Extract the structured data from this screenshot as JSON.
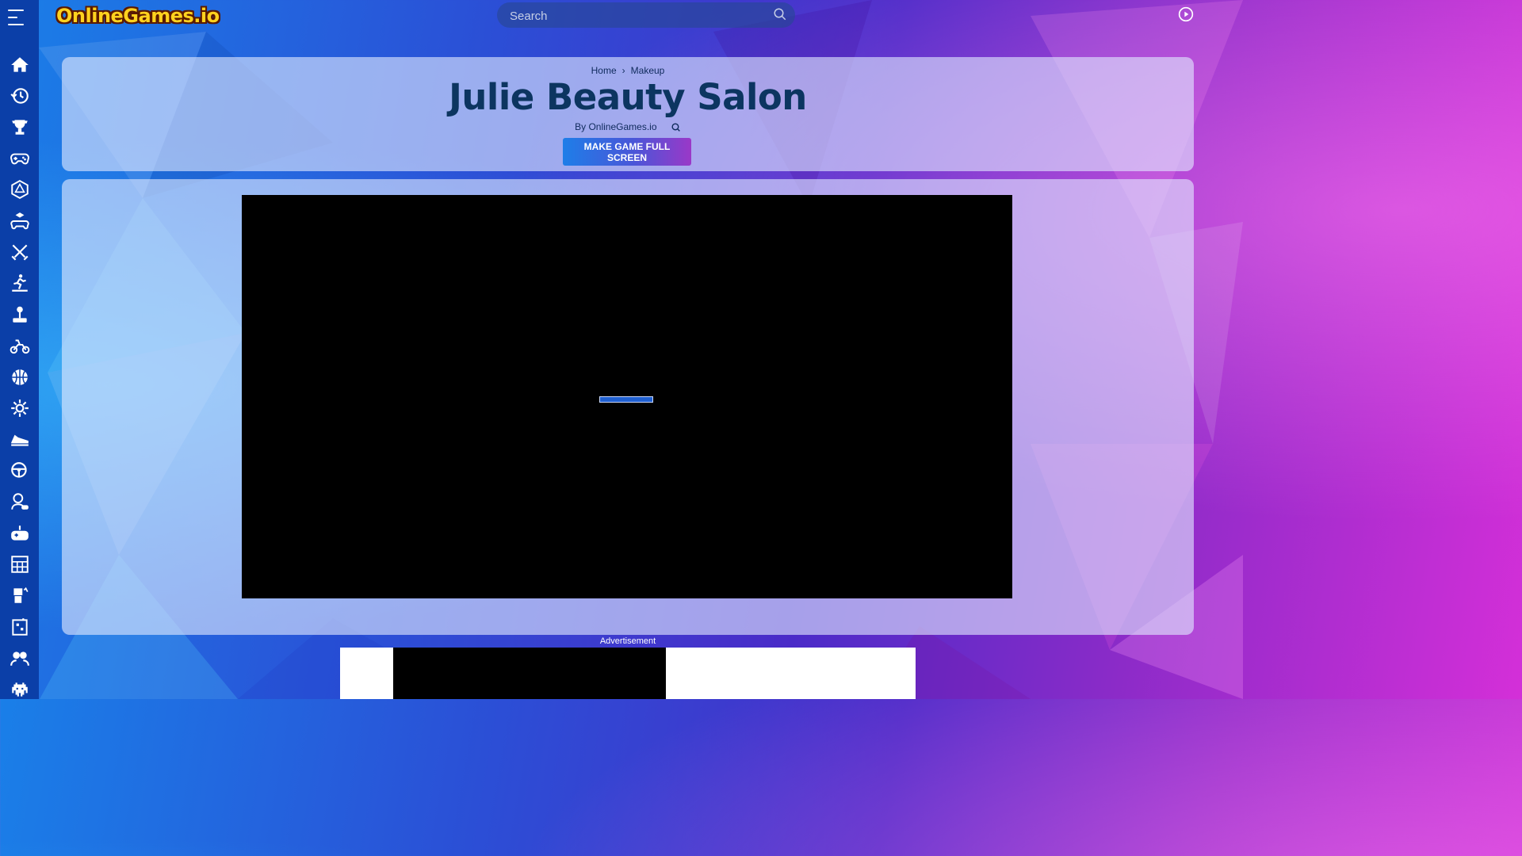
{
  "site": {
    "logo_text": "OnlineGames.io"
  },
  "search": {
    "placeholder": "Search"
  },
  "breadcrumb": {
    "items": [
      "Home",
      "Makeup"
    ]
  },
  "game": {
    "title": "Julie Beauty Salon",
    "byline": "By OnlineGames.io",
    "fullscreen_label": "MAKE GAME FULL SCREEN"
  },
  "ad": {
    "label": "Advertisement"
  },
  "sidebar": {
    "icons": [
      "home-icon",
      "history-icon",
      "trophy-icon",
      "gamepad-icon",
      "dice-icon",
      "cube-controller-icon",
      "crossed-swords-icon",
      "runner-icon",
      "joystick-icon",
      "motorbike-icon",
      "basketball-icon",
      "gear-icon",
      "sneaker-icon",
      "steering-wheel-icon",
      "girl-gamer-icon",
      "controller-plus-icon",
      "blocks-icon",
      "robot-icon",
      "puzzle-icon",
      "multiplayer-icon",
      "space-invader-icon"
    ]
  },
  "colors": {
    "sidebar": "#0b3fa8",
    "title": "#0c3560",
    "button_start": "#1e7ee8",
    "button_end": "#9a38c8"
  }
}
